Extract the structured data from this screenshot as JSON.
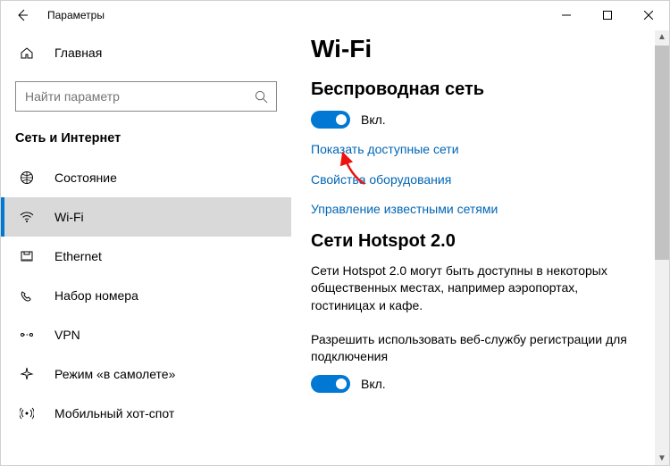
{
  "titlebar": {
    "title": "Параметры"
  },
  "sidebar": {
    "home_label": "Главная",
    "search_placeholder": "Найти параметр",
    "section": "Сеть и Интернет",
    "items": [
      {
        "label": "Состояние",
        "icon": "status"
      },
      {
        "label": "Wi-Fi",
        "icon": "wifi",
        "selected": true
      },
      {
        "label": "Ethernet",
        "icon": "ethernet"
      },
      {
        "label": "Набор номера",
        "icon": "dialup"
      },
      {
        "label": "VPN",
        "icon": "vpn"
      },
      {
        "label": "Режим «в самолете»",
        "icon": "airplane"
      },
      {
        "label": "Мобильный хот-спот",
        "icon": "hotspot"
      }
    ]
  },
  "content": {
    "page_title": "Wi-Fi",
    "wireless_head": "Беспроводная сеть",
    "toggle_on": "Вкл.",
    "links": [
      "Показать доступные сети",
      "Свойства оборудования",
      "Управление известными сетями"
    ],
    "hotspot_head": "Сети Hotspot 2.0",
    "hotspot_desc": "Сети Hotspot 2.0 могут быть доступны в некоторых общественных местах, например аэропортах, гостиницах и кафе.",
    "hotspot_allow": "Разрешить использовать веб-службу регистрации для подключения"
  }
}
